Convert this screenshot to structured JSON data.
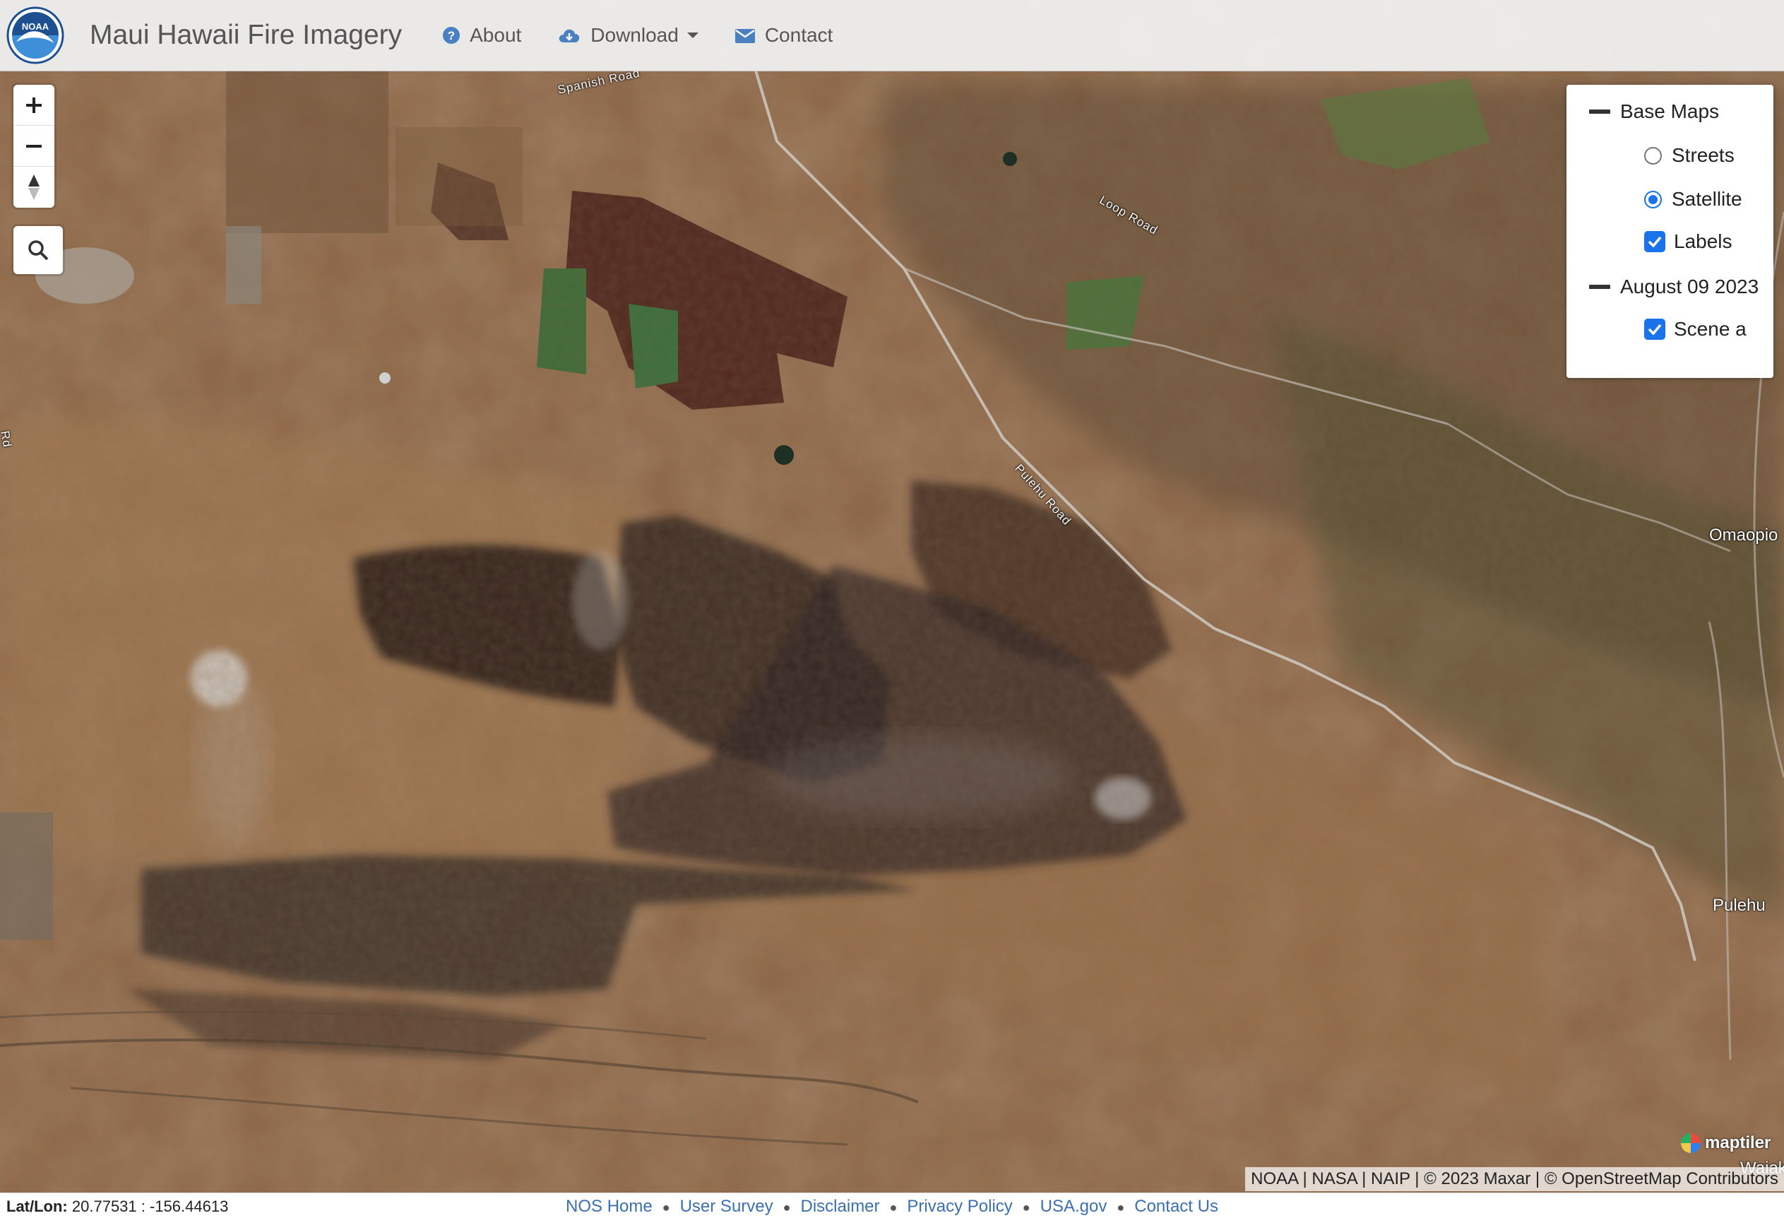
{
  "navbar": {
    "title": "Maui Hawaii Fire Imagery",
    "logo_text": "NOAA",
    "items": [
      {
        "label": "About",
        "icon": "question-circle-icon"
      },
      {
        "label": "Download",
        "icon": "cloud-download-icon"
      },
      {
        "label": "Contact",
        "icon": "envelope-icon"
      }
    ]
  },
  "map_controls": {
    "zoom_in": "+",
    "zoom_out": "−",
    "compass": "compass-icon",
    "search": "search-icon"
  },
  "layers": {
    "groups": [
      {
        "label": "Base Maps",
        "options": [
          {
            "label": "Streets",
            "type": "radio",
            "checked": false
          },
          {
            "label": "Satellite",
            "type": "radio",
            "checked": true
          },
          {
            "label": "Labels",
            "type": "checkbox",
            "checked": true
          }
        ]
      },
      {
        "label": "August 09 2023",
        "options": [
          {
            "label": "Scene a",
            "type": "checkbox",
            "checked": true
          }
        ]
      }
    ]
  },
  "map_labels": {
    "places": [
      "Omaopio",
      "Pulehu",
      "Waiakoa"
    ],
    "roads": [
      "Spanish Road",
      "Loop Road",
      "Pulehu Road",
      "Rd"
    ]
  },
  "attribution": "NOAA | NASA | NAIP | © 2023 Maxar | © OpenStreetMap Contributors",
  "maptiler": "maptiler",
  "footer": {
    "latlon_label": "Lat/Lon:",
    "latlon_value": "20.77531 : -156.44613",
    "links": [
      "NOS Home",
      "User Survey",
      "Disclaimer",
      "Privacy Policy",
      "USA.gov",
      "Contact Us"
    ]
  },
  "colors": {
    "accent": "#1a73e8",
    "link": "#3a6fb0",
    "terrain": "#8a6040",
    "burn_scar": "#2b2018",
    "vegetation": "#3f5a2e"
  }
}
